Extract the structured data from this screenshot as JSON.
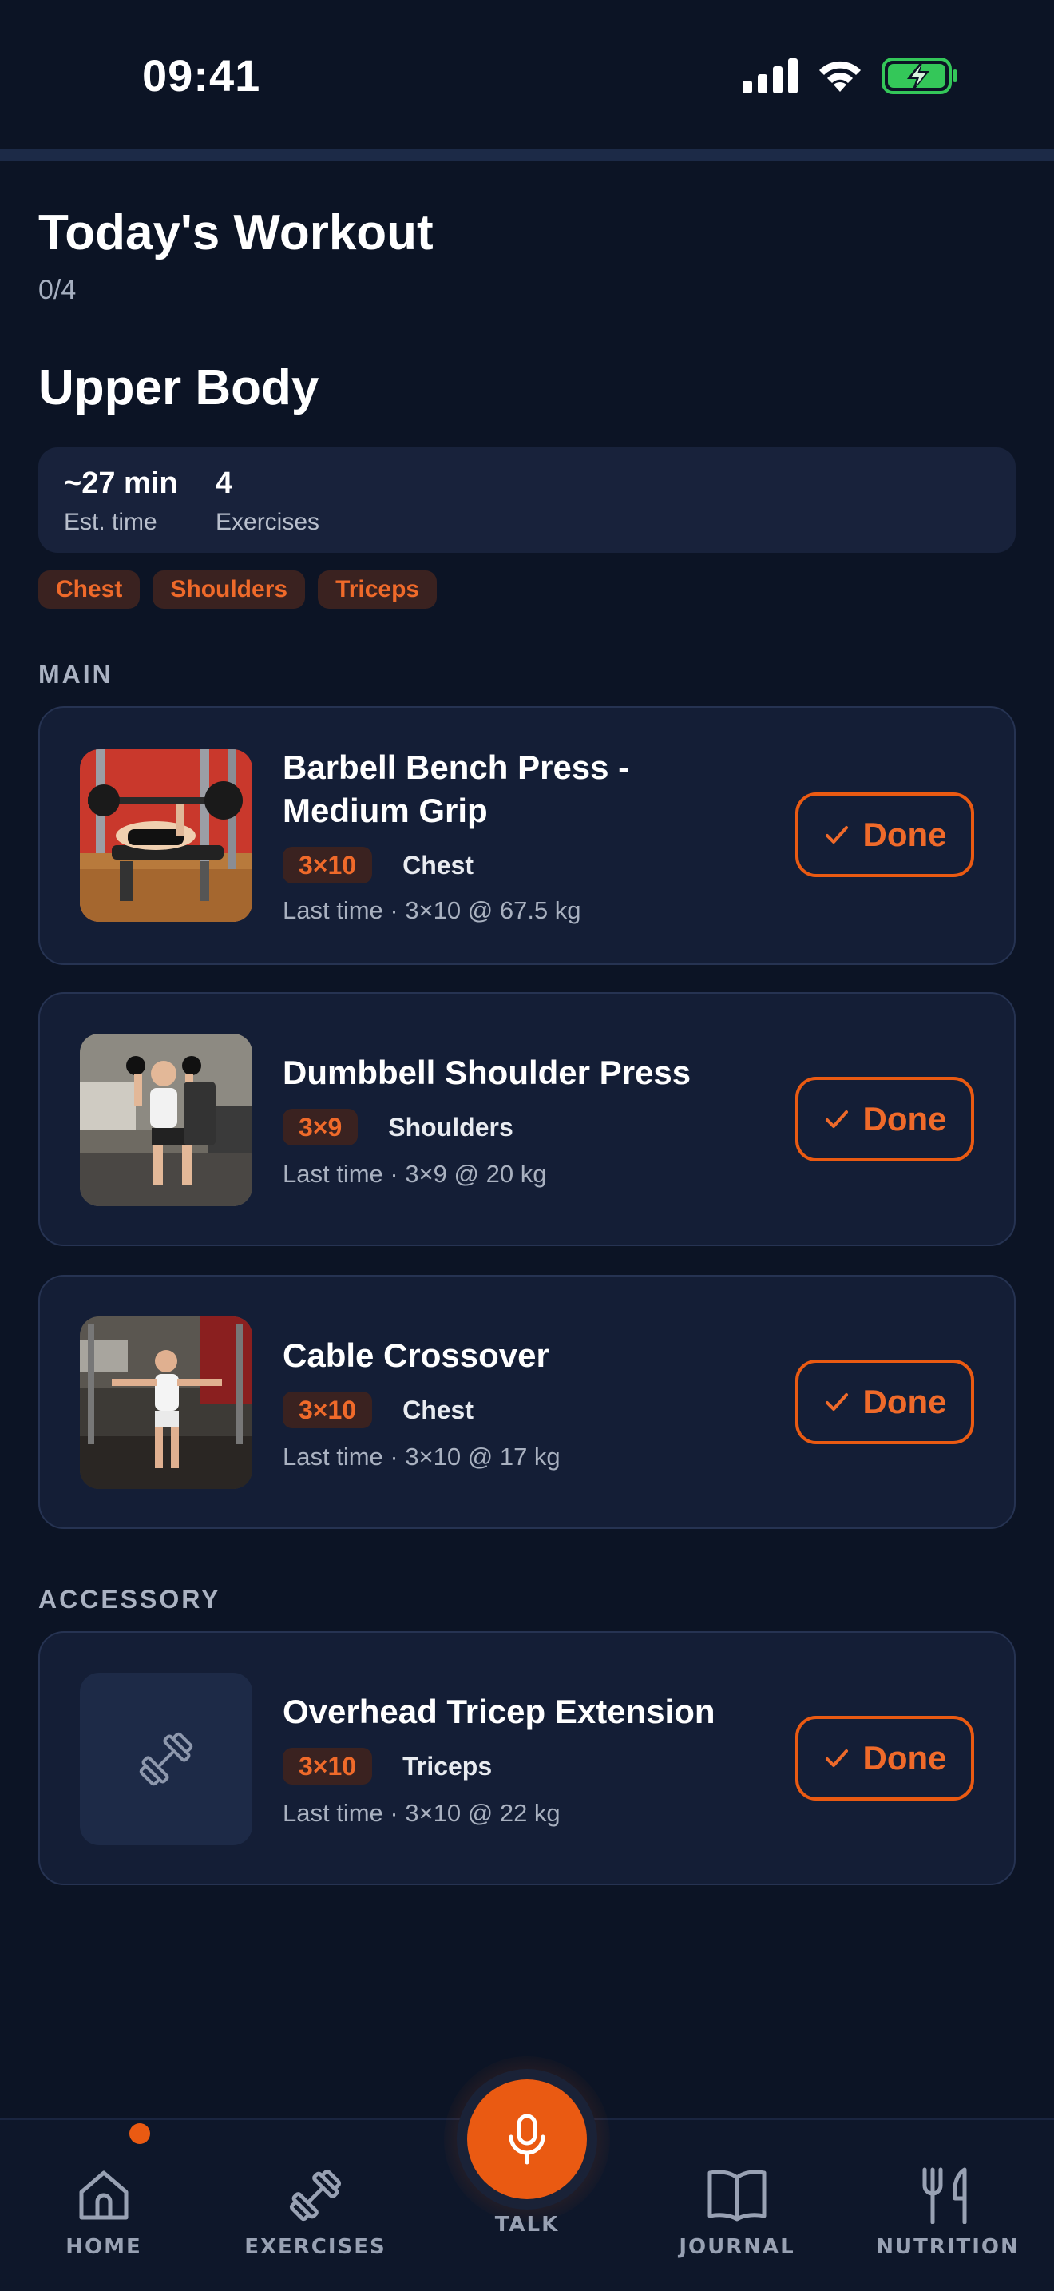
{
  "status_bar": {
    "time": "09:41"
  },
  "progress": {
    "completed": 0,
    "total": 4,
    "text": "0/4"
  },
  "header": {
    "title": "Today's Workout",
    "workout_name": "Upper Body"
  },
  "stats": {
    "time_value": "~27 min",
    "time_label": "Est. time",
    "exercises_value": "4",
    "exercises_label": "Exercises"
  },
  "muscle_tags": [
    "Chest",
    "Shoulders",
    "Triceps"
  ],
  "sections": {
    "main_label": "MAIN",
    "accessory_label": "ACCESSORY"
  },
  "exercises": [
    {
      "name": "Barbell Bench Press - Medium Grip",
      "sets": "3×10",
      "muscle": "Chest",
      "last_time": "Last time · 3×10 @ 67.5 kg",
      "done_label": "Done"
    },
    {
      "name": "Dumbbell Shoulder Press",
      "sets": "3×9",
      "muscle": "Shoulders",
      "last_time": "Last time · 3×9 @ 20 kg",
      "done_label": "Done"
    },
    {
      "name": "Cable Crossover",
      "sets": "3×10",
      "muscle": "Chest",
      "last_time": "Last time · 3×10 @ 17 kg",
      "done_label": "Done"
    },
    {
      "name": "Overhead Tricep Extension",
      "sets": "3×10",
      "muscle": "Triceps",
      "last_time": "Last time · 3×10 @ 22 kg",
      "done_label": "Done"
    }
  ],
  "nav": {
    "home": "HOME",
    "exercises": "EXERCISES",
    "talk": "TALK",
    "journal": "JOURNAL",
    "nutrition": "NUTRITION"
  },
  "colors": {
    "accent": "#ea5a12",
    "background": "#0c1425",
    "card": "#141e36"
  }
}
